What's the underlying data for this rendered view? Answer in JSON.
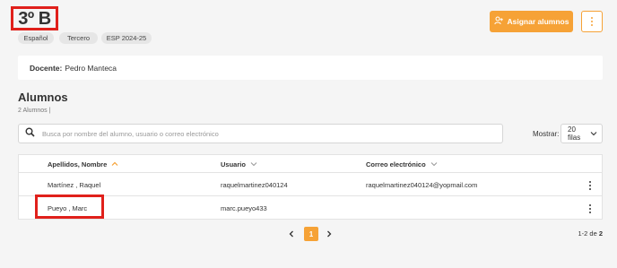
{
  "header": {
    "title": "3º B",
    "tags": [
      "Español",
      "Tercero",
      "ESP 2024-25"
    ],
    "assign_button_label": "Asignar alumnos"
  },
  "teacher": {
    "label": "Docente:",
    "name": "Pedro Manteca"
  },
  "students_section": {
    "title": "Alumnos",
    "count_text": "2 Alumnos |",
    "search_placeholder": "Busca por nombre del alumno, usuario o correo electrónico",
    "show_label": "Mostrar:",
    "rows_per_page": "20 filas"
  },
  "table": {
    "columns": [
      "Apellidos, Nombre",
      "Usuario",
      "Correo electrónico"
    ],
    "rows": [
      {
        "name": "Martínez , Raquel",
        "user": "raquelmartinez040124",
        "email": "raquelmartinez040124@yopmail.com"
      },
      {
        "name": "Pueyo , Marc",
        "user": "marc.pueyo433",
        "email": ""
      }
    ]
  },
  "pagination": {
    "current_page": "1",
    "range_text": "1-2 de ",
    "total": "2"
  },
  "colors": {
    "accent": "#f6a236",
    "highlight": "#e0201b"
  },
  "icons": [
    "user-plus-icon",
    "vertical-dots-icon",
    "search-icon",
    "chevron-down-icon",
    "sort-up-icon",
    "chevron-left-icon",
    "chevron-right-icon"
  ]
}
